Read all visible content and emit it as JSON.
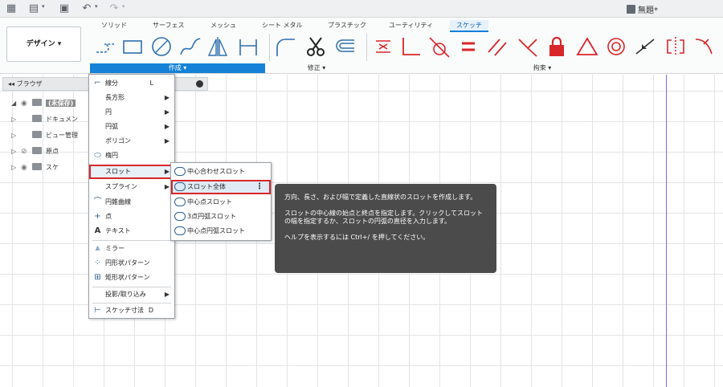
{
  "qat": {
    "doc_title": "無題*"
  },
  "ribbon": {
    "design_label": "デザイン ▾",
    "tabs": [
      {
        "label": "ソリッド"
      },
      {
        "label": "サーフェス"
      },
      {
        "label": "メッシュ"
      },
      {
        "label": "シート メタル"
      },
      {
        "label": "プラスチック"
      },
      {
        "label": "ユーティリティ"
      },
      {
        "label": "スケッチ"
      }
    ],
    "active_tab": "スケッチ",
    "groups": {
      "create": "作成 ▾",
      "modify": "修正 ▾",
      "constraints": "拘束 ▾"
    },
    "accent_color": "#1582d8",
    "constraint_color": "#d9262a"
  },
  "browser": {
    "title": "ブラウザ",
    "nodes": [
      {
        "label": "(未保存)"
      },
      {
        "label": "ドキュメン"
      },
      {
        "label": "ビュー管理"
      },
      {
        "label": "原点"
      },
      {
        "label": "スケ"
      }
    ]
  },
  "menu": {
    "items": [
      {
        "label": "線分",
        "shortcut": "L",
        "icon": "line-icon"
      },
      {
        "label": "長方形",
        "submenu": true
      },
      {
        "label": "円",
        "submenu": true
      },
      {
        "label": "円弧",
        "submenu": true
      },
      {
        "label": "ポリゴン",
        "submenu": true
      },
      {
        "label": "楕円",
        "icon": "ellipse-icon"
      },
      {
        "label": "スロット",
        "submenu": true,
        "highlighted": true
      },
      {
        "label": "スプライン",
        "submenu": true
      },
      {
        "label": "円錐曲線",
        "icon": "conic-icon"
      },
      {
        "label": "点",
        "icon": "point-icon"
      },
      {
        "label": "テキスト",
        "icon": "text-icon"
      },
      {
        "label": "ミラー",
        "icon": "mirror-icon"
      },
      {
        "label": "円形状パターン",
        "icon": "circular-pattern-icon"
      },
      {
        "label": "矩形状パターン",
        "icon": "rectangular-pattern-icon"
      },
      {
        "label": "投影/取り込み",
        "submenu": true
      },
      {
        "label": "スケッチ寸法",
        "shortcut": "D",
        "icon": "dimension-icon"
      }
    ]
  },
  "submenu": {
    "items": [
      {
        "label": "中心合わせスロット"
      },
      {
        "label": "スロット全体",
        "highlighted": true
      },
      {
        "label": "中心点スロット"
      },
      {
        "label": "3点円弧スロット"
      },
      {
        "label": "中心点円弧スロット"
      }
    ]
  },
  "tooltip": {
    "line1": "方向、長さ、および幅で定義した直線状のスロットを作成します。",
    "line2": "スロットの中心線の始点と終点を指定します。クリックしてスロットの幅を指定するか、スロットの円弧の直径を入力します。",
    "line3": "ヘルプを表示するには Ctrl+/ を押してください。"
  }
}
